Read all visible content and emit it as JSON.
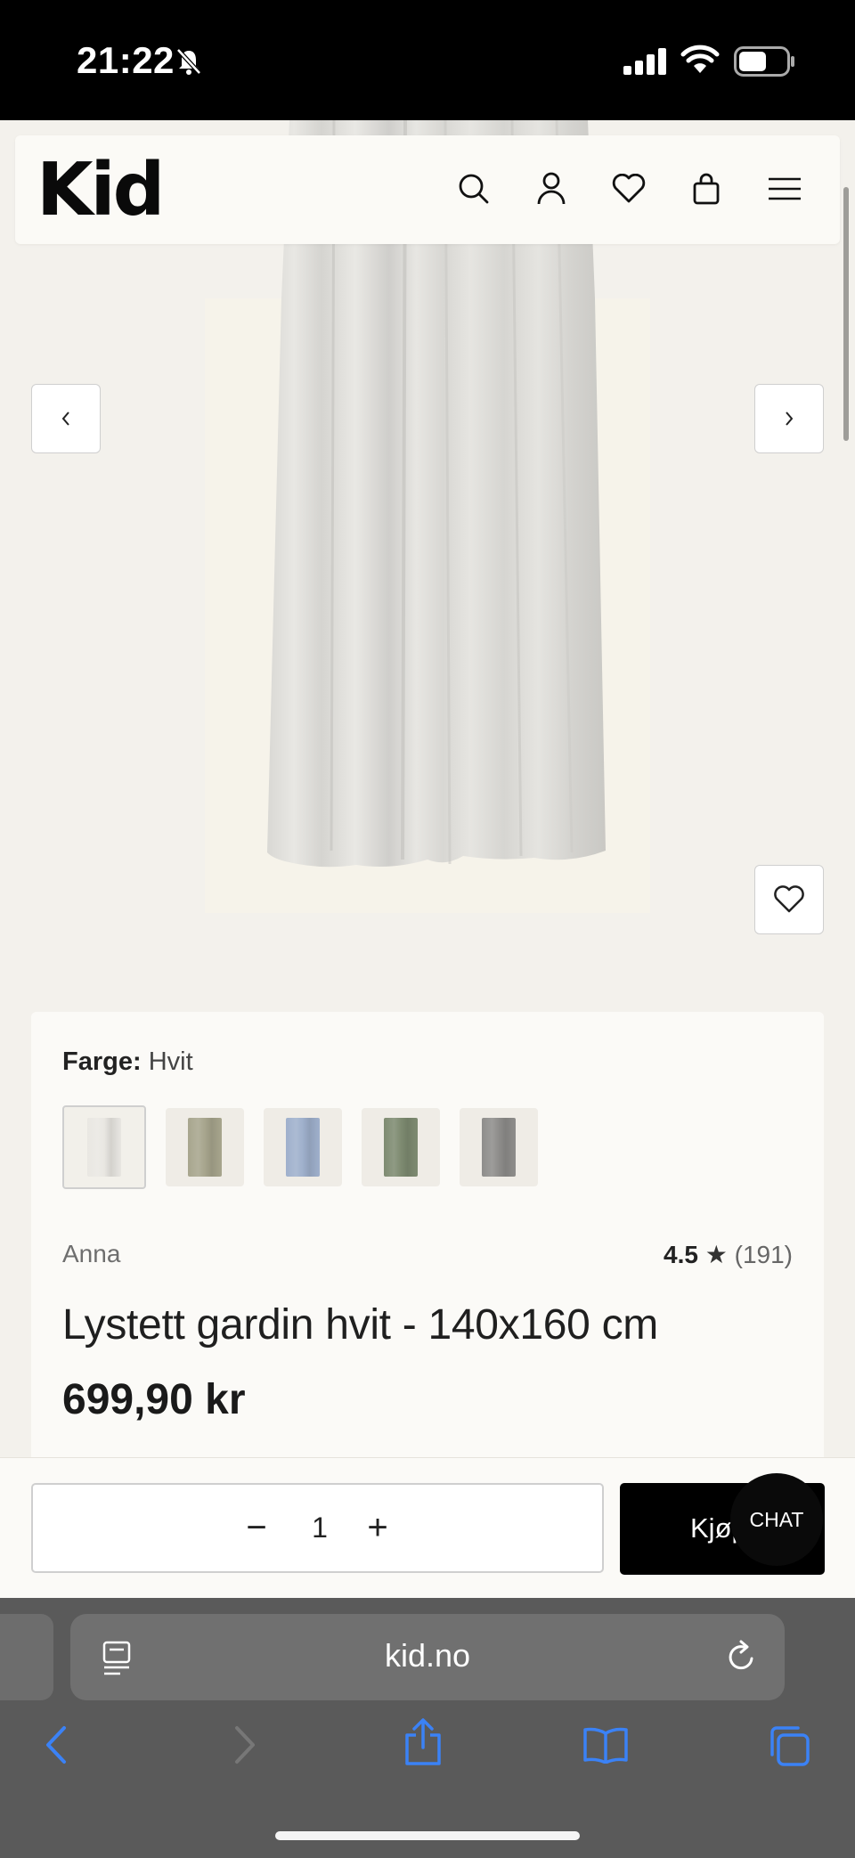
{
  "status_bar": {
    "time": "21:22"
  },
  "header": {
    "logo": "Kid"
  },
  "product": {
    "color_label": "Farge:",
    "color_value": "Hvit",
    "swatches": [
      {
        "name": "Hvit",
        "color": "#e9e7e2"
      },
      {
        "name": "swatch-2",
        "color": "#a7a58d"
      },
      {
        "name": "swatch-3",
        "color": "#9fb0cc"
      },
      {
        "name": "swatch-4",
        "color": "#7e8b71"
      },
      {
        "name": "swatch-5",
        "color": "#8e8d8b"
      }
    ],
    "brand": "Anna",
    "rating": "4.5",
    "rating_star": "★",
    "rating_count": "(191)",
    "title": "Lystett gardin hvit - 140x160 cm",
    "price": "699,90 kr"
  },
  "buy_bar": {
    "minus": "−",
    "quantity": "1",
    "plus": "+",
    "buy_label": "Kjøp",
    "chat_label": "CHAT"
  },
  "browser": {
    "url": "kid.no"
  },
  "colors": {
    "accent": "#3b82f6",
    "background": "#f3f1ec"
  }
}
